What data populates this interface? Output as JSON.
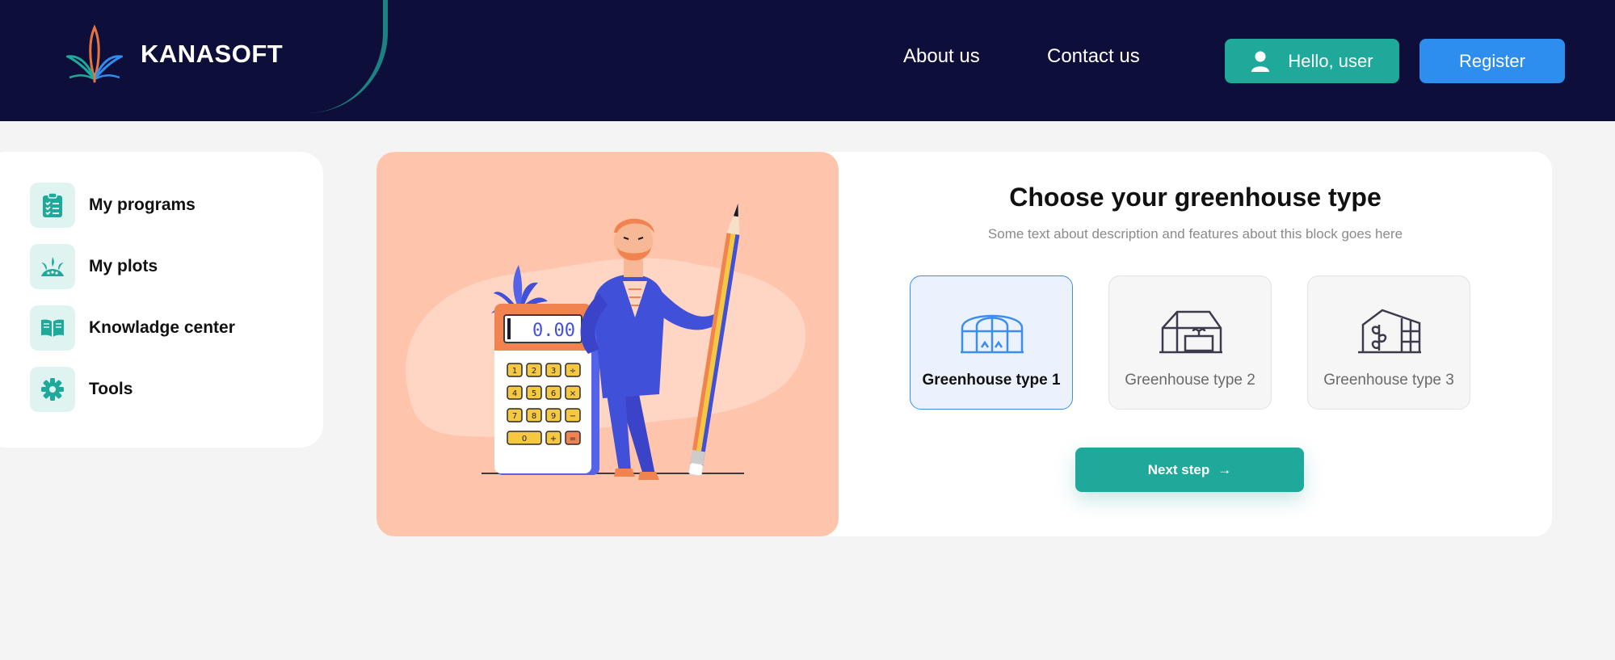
{
  "header": {
    "brand": "KANASOFT",
    "nav": [
      {
        "label": "About us"
      },
      {
        "label": "Contact us"
      }
    ],
    "hello_label": "Hello, user",
    "register_label": "Register"
  },
  "sidebar": {
    "items": [
      {
        "label": "My programs",
        "icon": "clipboard-checklist-icon"
      },
      {
        "label": "My plots",
        "icon": "plant-plot-icon"
      },
      {
        "label": "Knowladge center",
        "icon": "open-book-icon"
      },
      {
        "label": "Tools",
        "icon": "gear-icon"
      }
    ]
  },
  "illustration": {
    "calculator_display": "0.00",
    "keys": [
      "1",
      "2",
      "3",
      "÷",
      "4",
      "5",
      "6",
      "×",
      "7",
      "8",
      "9",
      "−",
      "0",
      "+",
      "="
    ]
  },
  "main": {
    "title": "Choose your greenhouse type",
    "subtitle": "Some text about description and features about this block goes here",
    "options": [
      {
        "label": "Greenhouse type 1",
        "selected": true
      },
      {
        "label": "Greenhouse type 2",
        "selected": false
      },
      {
        "label": "Greenhouse type 3",
        "selected": false
      }
    ],
    "next_label": "Next step"
  },
  "colors": {
    "header_bg": "#0e0e3a",
    "accent_teal": "#1fa99a",
    "accent_blue": "#2d8ef0",
    "illustration_bg": "#fec4ac"
  }
}
